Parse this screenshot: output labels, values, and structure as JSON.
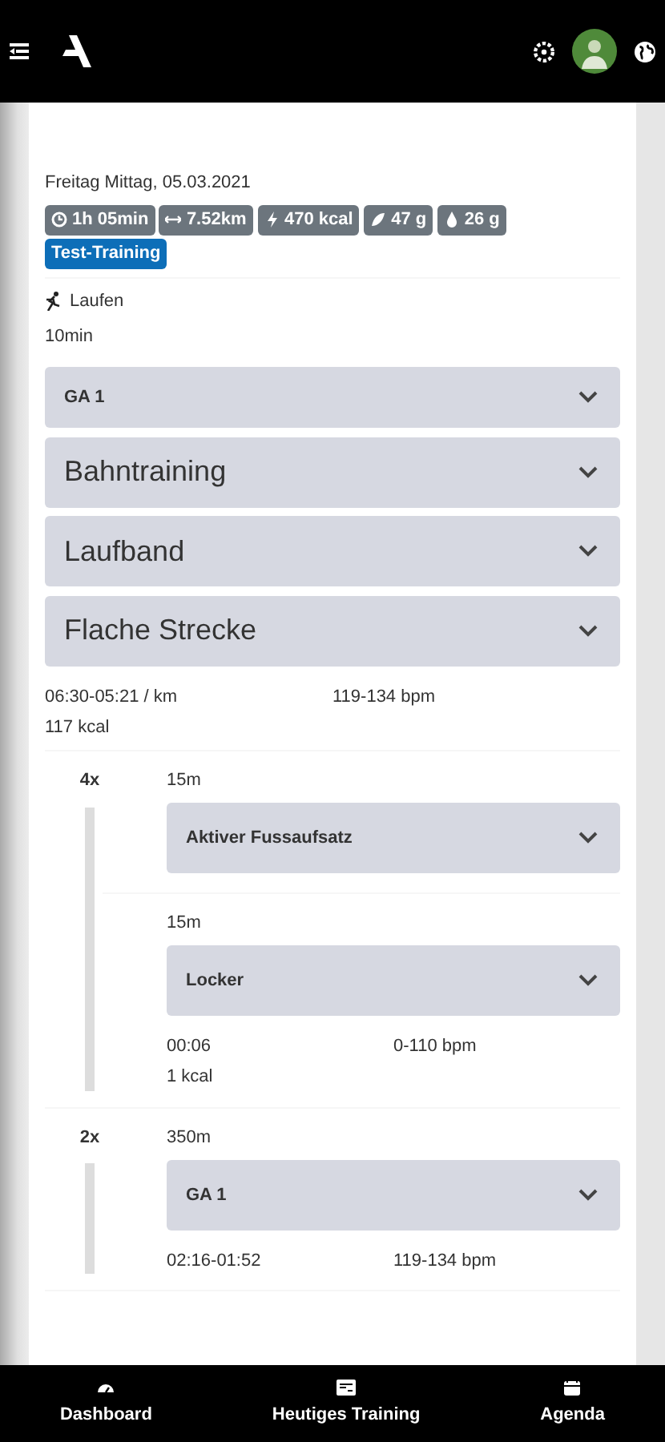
{
  "date": "Freitag Mittag, 05.03.2021",
  "stats": [
    {
      "kind": "time",
      "text": "1h 05min"
    },
    {
      "kind": "distance",
      "text": "7.52km"
    },
    {
      "kind": "energy",
      "text": "470 kcal"
    },
    {
      "kind": "carbs",
      "text": "47 g"
    },
    {
      "kind": "fat",
      "text": "26 g"
    }
  ],
  "tag": "Test-Training",
  "sport": "Laufen",
  "duration": "10min",
  "sections": [
    {
      "title": "GA 1",
      "kind": "compact",
      "expanded": false
    },
    {
      "title": "Bahntraining",
      "kind": "large",
      "expanded": false
    },
    {
      "title": "Laufband",
      "kind": "large",
      "expanded": false
    },
    {
      "title": "Flache Strecke",
      "kind": "large",
      "expanded": false
    }
  ],
  "summary": {
    "pace": "06:30-05:21 / km",
    "heart_rate": "119-134 bpm",
    "energy": "117 kcal"
  },
  "intervals": [
    {
      "repeat": "4x",
      "steps": [
        {
          "distance": "15m",
          "title": "Aktiver Fussaufsatz",
          "expanded": false
        },
        {
          "distance": "15m",
          "title": "Locker",
          "expanded": false,
          "pace": "00:06",
          "heart_rate": "0-110 bpm",
          "energy": "1 kcal"
        }
      ]
    },
    {
      "repeat": "2x",
      "steps": [
        {
          "distance": "350m",
          "title": "GA 1",
          "expanded": false,
          "pace": "02:16-01:52",
          "heart_rate": "119-134 bpm"
        }
      ]
    }
  ],
  "bottom_nav": [
    {
      "kind": "dashboard",
      "label": "Dashboard"
    },
    {
      "kind": "training",
      "label": "Heutiges Training"
    },
    {
      "kind": "agenda",
      "label": "Agenda"
    }
  ]
}
